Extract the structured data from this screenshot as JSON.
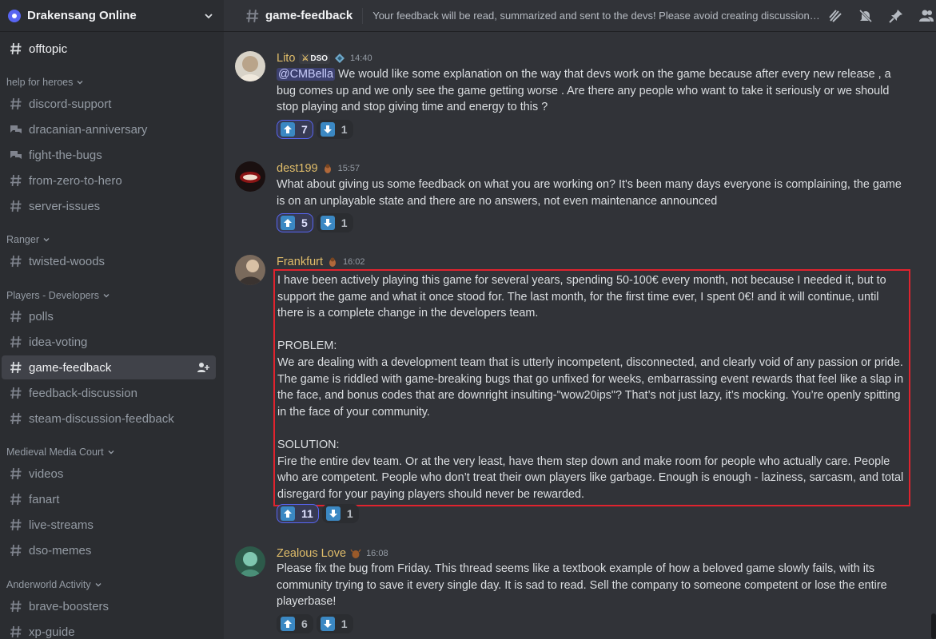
{
  "server": {
    "name": "Drakensang Online"
  },
  "sidebar": {
    "top_channel": "offtopic",
    "categories": [
      {
        "label": "help for heroes",
        "channels": [
          "discord-support",
          "dracanian-anniversary",
          "fight-the-bugs",
          "from-zero-to-hero",
          "server-issues"
        ]
      },
      {
        "label": "Ranger",
        "channels": [
          "twisted-woods"
        ]
      },
      {
        "label": "Players - Developers",
        "channels": [
          "polls",
          "idea-voting",
          "game-feedback",
          "feedback-discussion",
          "steam-discussion-feedback"
        ]
      },
      {
        "label": "Medieval Media Court",
        "channels": [
          "videos",
          "fanart",
          "live-streams",
          "dso-memes"
        ]
      },
      {
        "label": "Anderworld Activity",
        "channels": [
          "brave-boosters",
          "xp-guide"
        ]
      }
    ]
  },
  "header": {
    "channel_name": "game-feedback",
    "topic": "Your feedback will be read, summarized and sent to the devs! Please avoid creating discussions in ..."
  },
  "messages": [
    {
      "user": "Lito",
      "user_color": "#e0bd6a",
      "badge": "DSO",
      "time": "14:40",
      "mention": "@CMBella",
      "text": " We would like some explanation on the way that devs work on the game because after every new release , a bug comes up and we only see the game getting worse . Are there any people who want to take it seriously or we should stop playing and stop giving time and energy to this ?",
      "up": "7",
      "down": "1"
    },
    {
      "user": "dest199",
      "user_color": "#e0bd6a",
      "time": "15:57",
      "text": "What about giving us some feedback on what you are working on? It's been many days everyone is complaining, the game is on an unplayable state and there are no answers, not even maintenance announced",
      "up": "5",
      "down": "1"
    },
    {
      "user": "Frankfurt",
      "user_color": "#e0bd6a",
      "time": "16:02",
      "paragraphs": [
        "I have been actively playing this game for several years, spending 50-100€ every month, not because I needed it, but to support the game and what it once stood for. The last month, for the first time ever, I spent 0€! and it will continue, until there is a complete change in the developers team.",
        "PROBLEM:\nWe are dealing with a development team that is utterly incompetent, disconnected, and clearly void of any passion or pride. The game is riddled with game-breaking bugs that go unfixed for weeks, embarrassing event rewards that feel like a slap in the face, and bonus codes that are downright insulting-\"wow20ips\"? That’s not just lazy, it’s mocking. You’re openly spitting in the face of your community.",
        "SOLUTION:\nFire the entire dev team. Or at the very least, have them step down and make room for people who actually care. People who are competent. People who don’t treat their own players like garbage. Enough is enough - laziness, sarcasm, and total disregard for your paying players should never be rewarded."
      ],
      "up": "11",
      "down": "1"
    },
    {
      "user": "Zealous Love",
      "user_color": "#e0bd6a",
      "time": "16:08",
      "text": "Please fix the bug from Friday. This thread seems like a textbook example of how a beloved game slowly fails, with its community trying to save it every single day. It is sad to read. Sell the company to someone competent or lose the entire playerbase!",
      "up": "6",
      "down": "1"
    }
  ],
  "colors": {
    "accent": "#5865f2",
    "highlight_border": "#e0232e",
    "username": "#e0bd6a"
  }
}
